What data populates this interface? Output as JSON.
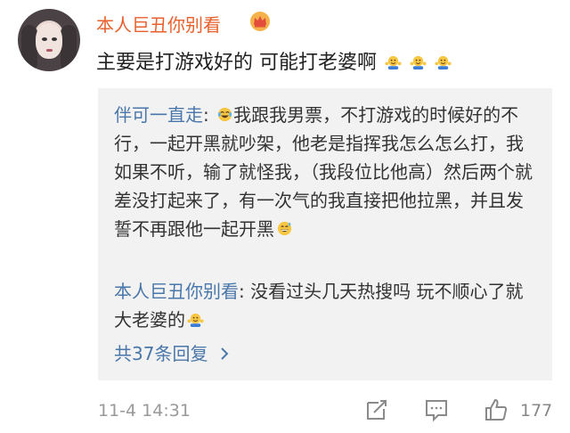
{
  "comment": {
    "username": "本人巨丑你别看",
    "text": "主要是打游戏好的 可能打老婆啊",
    "emoji_icons": [
      "shrug-emoji-icon",
      "shrug-emoji-icon",
      "shrug-emoji-icon"
    ],
    "timestamp": "11-4 14:31",
    "like_count": "177"
  },
  "replies": [
    {
      "username": "伴可一直走",
      "separator": ":",
      "text_before_emoji": "",
      "emoji": "tears-of-joy-icon",
      "text": "我跟我男票，不打游戏的时候好的不行，一起开黑就吵架，他老是指挥我怎么怎么打，我如果不听，输了就怪我，（我段位比他高）然后两个就差没打起来了，有一次气的我直接把他拉黑，并且发誓不再跟他一起开黑",
      "trailing_emoji": "grinning-sweat-icon"
    },
    {
      "username": "本人巨丑你别看",
      "separator": ":",
      "text": " 没看过头几天热搜吗 玩不顺心了就大老婆的",
      "trailing_emoji": "shrug-emoji-icon"
    }
  ],
  "total_replies_label": "共37条回复",
  "total_replies_chevron": "chevron-right-icon",
  "actions": [
    "share-icon",
    "comment-icon",
    "like-icon"
  ],
  "colors": {
    "username_orange": "#e8602c",
    "reply_name_blue": "#4a77aa",
    "reply_bg": "#f2f2f2",
    "meta_gray": "#999999"
  }
}
